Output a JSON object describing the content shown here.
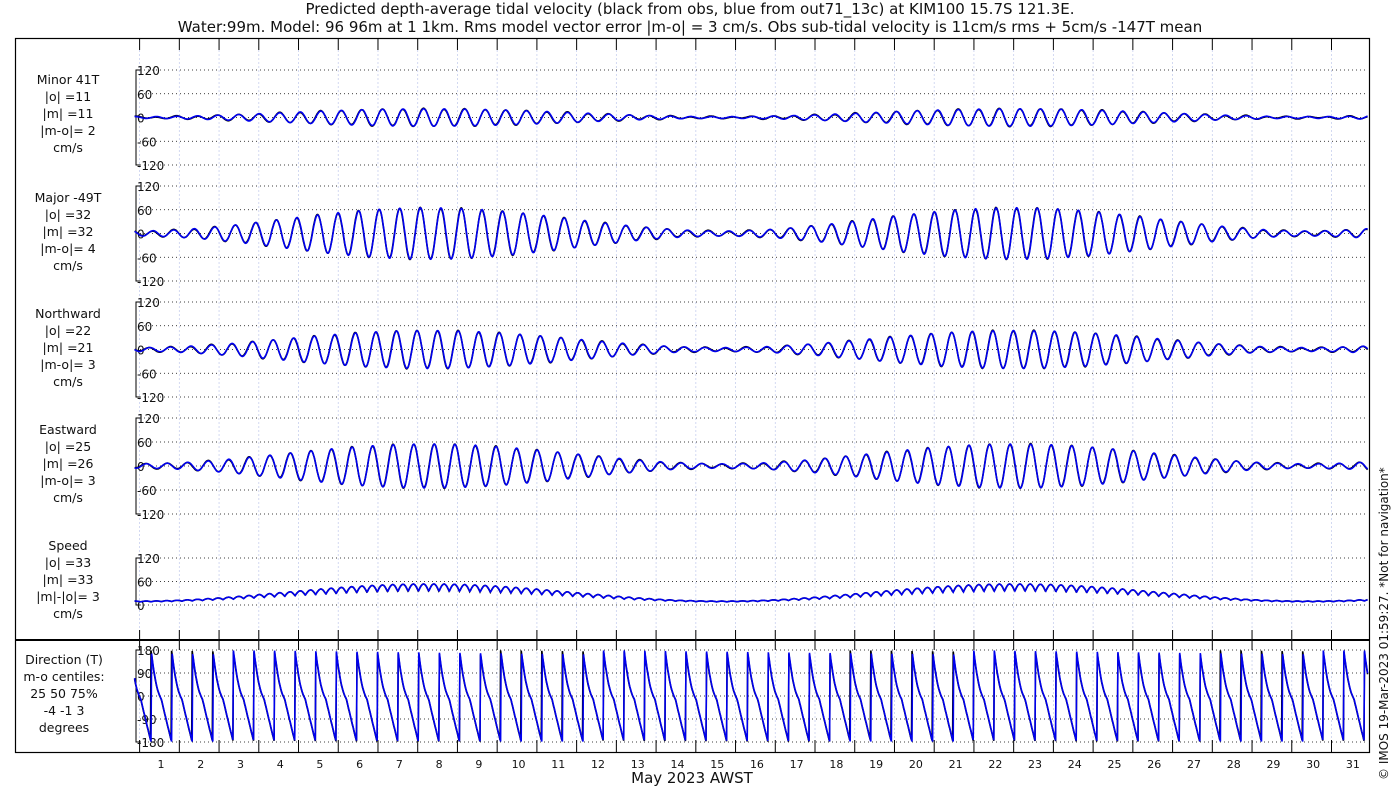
{
  "chart_data": {
    "type": "line",
    "title": "Predicted depth-average tidal velocity (black from obs, blue from out71_13c) at KIM100 15.7S 121.3E.",
    "subtitle": "Water:99m. Model: 96 96m at 1 1km. Rms model vector error |m-o| = 3 cm/s. Obs sub-tidal velocity is 11cm/s rms + 5cm/s -147T mean",
    "xlabel": "May 2023 AWST",
    "x_ticks": [
      "1",
      "2",
      "3",
      "4",
      "5",
      "6",
      "7",
      "8",
      "9",
      "10",
      "11",
      "12",
      "13",
      "14",
      "15",
      "16",
      "17",
      "18",
      "19",
      "20",
      "21",
      "22",
      "23",
      "24",
      "25",
      "26",
      "27",
      "28",
      "29",
      "30",
      "31"
    ],
    "xlim_days": [
      0.4,
      31.5
    ],
    "copyright": "© IMOS 19-Mar-2023 01:59:27. *Not for navigation*",
    "series_legend": [
      {
        "name": "obs",
        "color": "#000000"
      },
      {
        "name": "model out71_13c",
        "color": "#0000ee"
      }
    ],
    "panels": [
      {
        "id": "minor",
        "labels": [
          "Minor 41T",
          "|o| =11",
          "|m| =11",
          "|m-o|= 2",
          "cm/s"
        ],
        "ylim": [
          -120,
          120
        ],
        "yticks": [
          "120",
          "60",
          "0",
          "-60",
          "-120"
        ],
        "amplitude": 22,
        "offset": 0,
        "kind": "wave"
      },
      {
        "id": "major",
        "labels": [
          "Major -49T",
          "|o| =32",
          "|m| =32",
          "|m-o|= 4",
          "cm/s"
        ],
        "ylim": [
          -120,
          120
        ],
        "yticks": [
          "120",
          "60",
          "0",
          "-60",
          "-120"
        ],
        "amplitude": 65,
        "offset": 0,
        "kind": "wave"
      },
      {
        "id": "northward",
        "labels": [
          "Northward",
          "|o| =22",
          "|m| =21",
          "|m-o|= 3",
          "cm/s"
        ],
        "ylim": [
          -120,
          120
        ],
        "yticks": [
          "120",
          "60",
          "0",
          "-60",
          "-120"
        ],
        "amplitude": 48,
        "offset": 0,
        "kind": "wave"
      },
      {
        "id": "eastward",
        "labels": [
          "Eastward",
          "|o| =25",
          "|m| =26",
          "|m-o|= 3",
          "cm/s"
        ],
        "ylim": [
          -120,
          120
        ],
        "yticks": [
          "120",
          "60",
          "0",
          "-60",
          "-120"
        ],
        "amplitude": 55,
        "offset": 0,
        "kind": "wave"
      },
      {
        "id": "speed",
        "labels": [
          "Speed",
          "|o| =33",
          "|m| =33",
          "|m|-|o|= 3",
          "cm/s"
        ],
        "ylim": [
          0,
          120
        ],
        "yticks": [
          "120",
          "60",
          "0"
        ],
        "amplitude": 65,
        "offset": 0,
        "kind": "speed"
      },
      {
        "id": "direction",
        "labels": [
          "Direction (T)",
          "m-o centiles:",
          "25  50  75%",
          "-4 -1  3",
          "degrees"
        ],
        "ylim": [
          -180,
          180
        ],
        "yticks": [
          "180",
          "90",
          "0",
          "-90",
          "-180"
        ],
        "kind": "direction"
      }
    ]
  }
}
